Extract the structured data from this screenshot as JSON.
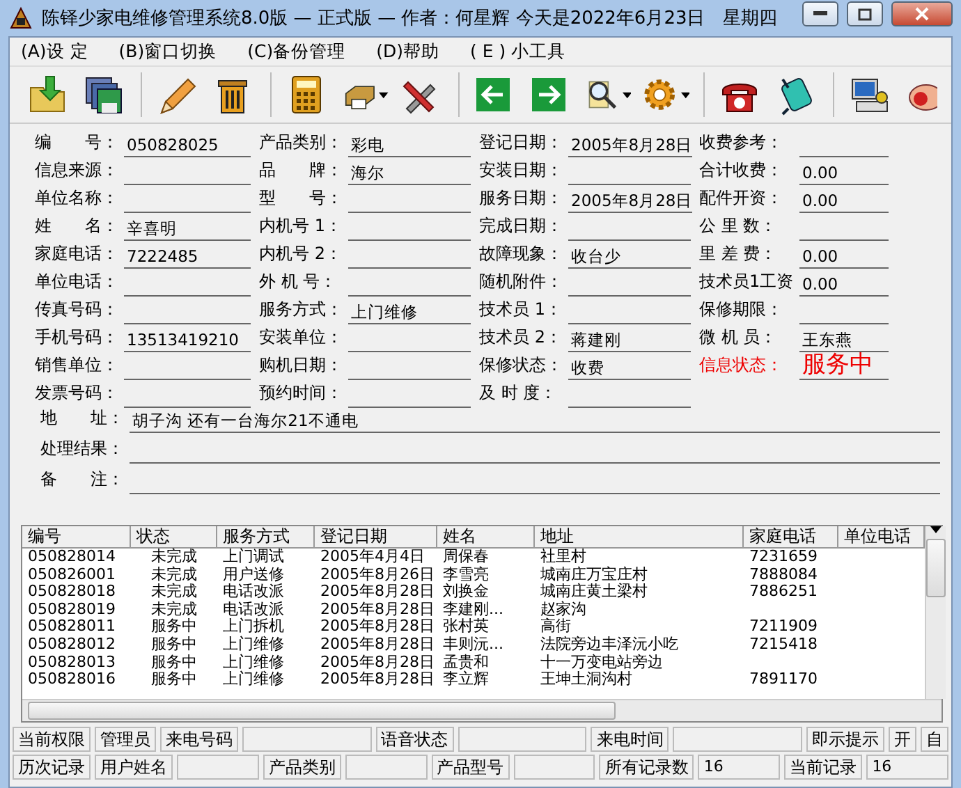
{
  "window": {
    "title": "陈铎少家电维修管理系统8.0版 — 正式版 — 作者：何星辉 今天是2022年6月23日　星期四"
  },
  "menu": [
    "(A)设 定",
    "(B)窗口切换",
    "(C)备份管理",
    "(D)帮助",
    "( E ) 小工具"
  ],
  "form": {
    "columns": [
      [
        {
          "label": "编　　号：",
          "value": "050828025"
        },
        {
          "label": "信息来源："
        },
        {
          "label": "单位名称："
        },
        {
          "label": "姓　　名：",
          "value": "辛喜明"
        },
        {
          "label": "家庭电话：",
          "value": "7222485"
        },
        {
          "label": "单位电话："
        },
        {
          "label": "传真号码："
        },
        {
          "label": "手机号码：",
          "value": "13513419210"
        },
        {
          "label": "销售单位："
        },
        {
          "label": "发票号码："
        }
      ],
      [
        {
          "label": "产品类别：",
          "value": "彩电"
        },
        {
          "label": "品　　牌：",
          "value": "海尔"
        },
        {
          "label": "型　　号："
        },
        {
          "label": "内机号 1："
        },
        {
          "label": "内机号 2："
        },
        {
          "label": "外 机 号："
        },
        {
          "label": "服务方式：",
          "value": "上门维修"
        },
        {
          "label": "安装单位："
        },
        {
          "label": "购机日期："
        },
        {
          "label": "预约时间："
        }
      ],
      [
        {
          "label": "登记日期：",
          "value": "2005年8月28日"
        },
        {
          "label": "安装日期："
        },
        {
          "label": "服务日期：",
          "value": "2005年8月28日"
        },
        {
          "label": "完成日期："
        },
        {
          "label": "故障现象：",
          "value": "收台少"
        },
        {
          "label": "随机附件："
        },
        {
          "label": "技术员 1："
        },
        {
          "label": "技术员 2：",
          "value": "蒋建刚"
        },
        {
          "label": "保修状态：",
          "value": "收费"
        },
        {
          "label": "及 时 度："
        }
      ],
      [
        {
          "kind": "field",
          "label": "收费参考："
        },
        {
          "kind": "field",
          "label": "合计收费：",
          "value": "0.00"
        },
        {
          "kind": "field",
          "label": "配件开资：",
          "value": "0.00"
        },
        {
          "kind": "field",
          "label": "公 里 数："
        },
        {
          "kind": "field",
          "label": "里 差 费：",
          "value": "0.00"
        },
        {
          "kind": "field",
          "label": "技术员1工资",
          "value": "0.00"
        },
        {
          "kind": "field",
          "label": "保修期限："
        },
        {
          "kind": "field",
          "label": "微 机 员：",
          "value": "王东燕"
        },
        {
          "kind": "status",
          "label": "信息状态：",
          "value": "服务中"
        }
      ]
    ],
    "wide": [
      {
        "label": "地　　址：",
        "value": "胡子沟 还有一台海尔21不通电"
      },
      {
        "label": "处理结果："
      },
      {
        "label": "备　　注："
      }
    ]
  },
  "table": {
    "columns": [
      "编号",
      "状态",
      "服务方式",
      "登记日期",
      "姓名",
      "地址",
      "家庭电话",
      "单位电话"
    ],
    "rows": [
      [
        "050828014",
        "未完成",
        "上门调试",
        "2005年4月4日",
        "周保春",
        "社里村",
        "7231659",
        null
      ],
      [
        "050826001",
        "未完成",
        "用户送修",
        "2005年8月26日",
        "李雪亮",
        "城南庄万宝庄村",
        "7888084",
        null
      ],
      [
        "050828018",
        "未完成",
        "电话改派",
        "2005年8月28日",
        "刘换金",
        "城南庄黄土梁村",
        "7886251",
        null
      ],
      [
        "050828019",
        "未完成",
        "电话改派",
        "2005年8月28日",
        "李建刚...",
        "赵家沟",
        null,
        null
      ],
      [
        "050828011",
        "服务中",
        "上门拆机",
        "2005年8月28日",
        "张村英",
        "高街",
        "7211909",
        null
      ],
      [
        "050828012",
        "服务中",
        "上门维修",
        "2005年8月28日",
        "丰则沅...",
        "法院旁边丰泽沅小吃",
        "7215418",
        null
      ],
      [
        "050828013",
        "服务中",
        "上门维修",
        "2005年8月28日",
        "孟贵和",
        "十一万变电站旁边",
        null,
        null
      ],
      [
        "050828016",
        "服务中",
        "上门维修",
        "2005年8月28日",
        "李立辉",
        "王坤土洞沟村",
        "7891170",
        null
      ]
    ]
  },
  "status_rows": [
    [
      {
        "kind": "label",
        "text": "当前权限"
      },
      {
        "kind": "label",
        "text": "管理员"
      },
      {
        "kind": "label",
        "text": "来电号码"
      },
      {
        "kind": "box"
      },
      {
        "kind": "label",
        "text": "语音状态"
      },
      {
        "kind": "box"
      },
      {
        "kind": "label",
        "text": "来电时间"
      },
      {
        "kind": "box"
      },
      {
        "kind": "label",
        "text": "即示提示"
      },
      {
        "kind": "label",
        "text": "开"
      },
      {
        "kind": "label",
        "text": "自"
      }
    ],
    [
      {
        "kind": "label",
        "text": "历次记录"
      },
      {
        "kind": "label",
        "text": "用户姓名"
      },
      {
        "kind": "box"
      },
      {
        "kind": "label",
        "text": "产品类别"
      },
      {
        "kind": "box"
      },
      {
        "kind": "label",
        "text": "产品型号"
      },
      {
        "kind": "box"
      },
      {
        "kind": "label",
        "text": "所有记录数"
      },
      {
        "kind": "box",
        "text": "16"
      },
      {
        "kind": "label",
        "text": "当前记录"
      },
      {
        "kind": "box",
        "text": "16"
      }
    ]
  ]
}
